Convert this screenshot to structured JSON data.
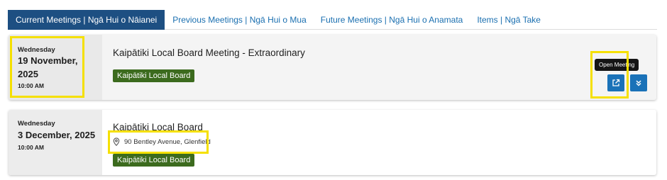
{
  "tabs": [
    {
      "label": "Current Meetings | Ngā Hui o Nāianei",
      "active": true
    },
    {
      "label": "Previous Meetings | Ngā Hui o Mua",
      "active": false
    },
    {
      "label": "Future Meetings | Ngā Hui o Anamata",
      "active": false
    },
    {
      "label": "Items | Ngā Take",
      "active": false
    }
  ],
  "meetings": [
    {
      "weekday": "Wednesday",
      "date_line1": "19 November,",
      "date_line2": "2025",
      "time": "10:00 AM",
      "title": "Kaipātiki Local Board Meeting - Extraordinary",
      "board": "Kaipātiki Local Board",
      "location": "",
      "tooltip": "Open Meeting",
      "open_icon": "external-link-icon",
      "expand_icon": "double-chevron-down-icon"
    },
    {
      "weekday": "Wednesday",
      "date_line1": "3 December, 2025",
      "time": "10:00 AM",
      "title": "Kaipātiki Local Board",
      "board": "Kaipātiki Local Board",
      "location": "90 Bentley Avenue, Glenfield",
      "location_icon": "map-pin-icon"
    }
  ],
  "colors": {
    "active_tab": "#1d4f82",
    "tab_text": "#1a6fb0",
    "badge": "#3c6b1e",
    "button": "#1a72b8",
    "highlight": "#f5e000"
  }
}
